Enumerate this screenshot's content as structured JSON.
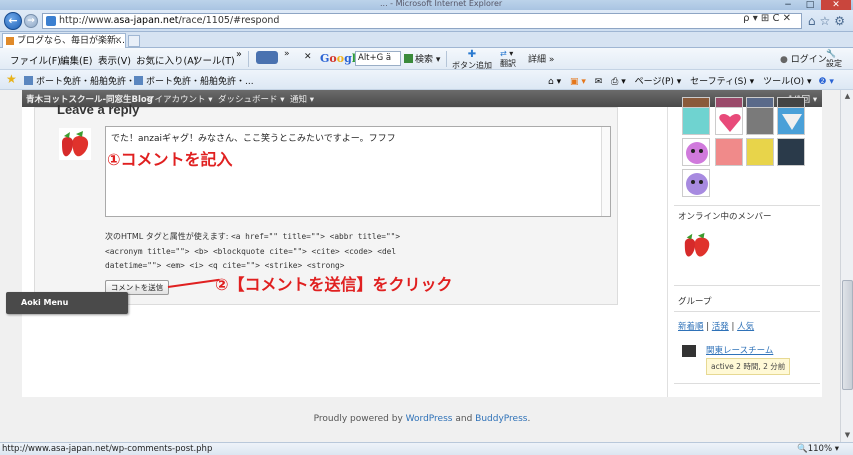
{
  "window": {
    "title": "... - Microsoft Internet Explorer"
  },
  "address": {
    "url_prefix": "http://www.",
    "url_domain": "asa-japan.net",
    "url_suffix": "/race/1105/#respond",
    "tools": "ρ ▾ ⊞ C ✕"
  },
  "tab": {
    "title": "ブログなら、毎日が楽新…",
    "close": "✕"
  },
  "menu": {
    "file": "ファイル(F)",
    "edit": "編集(E)",
    "view": "表示(V)",
    "favorites": "お気に入り(A)",
    "tools": "ツール(T)",
    "more": "»",
    "close_x": "✕",
    "google_search_value": "Alt+G ä",
    "search_btn": "検索",
    "button_add": "ボタン追加",
    "translate": "翻訳",
    "details": "詳細 »",
    "login": "ログイン",
    "settings": "設定"
  },
  "favbar": {
    "link1": "ボート免許・船舶免許・...",
    "link2": "ボート免許・船舶免許・...",
    "commands": {
      "page": "ページ(P) ▾",
      "safety": "セーフティ(S) ▾",
      "tools": "ツール(O) ▾",
      "help": "❷ ▾"
    }
  },
  "adminbar": {
    "site": "青木ヨットスクール-同窓生Blog",
    "my_account": "マイアカウント ▾",
    "dashboard": "ダッシュボード ▾",
    "notifications": "通知 ▾",
    "right_label": "1/1回 ▾"
  },
  "comment_form": {
    "heading": "Leave a reply",
    "textarea_value": "でた！anzaiギャグ！みなさん、ここ笑うとこみたいですよー。フフフ",
    "annotation1": "①コメントを記入",
    "allowed_intro": "次のHTML タグと属性が使えます:",
    "allowed_line1_code": "<a href=\"\" title=\"\"> <abbr title=\"\">",
    "allowed_line2_code": "<acronym title=\"\"> <b> <blockquote cite=\"\"> <cite> <code> <del",
    "allowed_line3_code": "datetime=\"\"> <em> <i> <q cite=\"\"> <strike> <strong>",
    "submit_label": "コメントを送信",
    "annotation2": "②【コメントを送信】をクリック"
  },
  "aoki_menu": {
    "label": "Aoki Menu"
  },
  "sidebar": {
    "online_members_title": "オンライン中のメンバー",
    "groups_title": "グループ",
    "group_tabs": {
      "newest": "新着順",
      "active": "活発",
      "popular": "人気"
    },
    "group_name": "関東レースチーム",
    "group_active": "active 2 時間, 2 分前"
  },
  "footer": {
    "prefix": "Proudly powered by ",
    "wordpress": "WordPress",
    "and": " and ",
    "buddypress": "BuddyPress",
    "suffix": "."
  },
  "status": {
    "url": "http://www.asa-japan.net/wp-comments-post.php",
    "zoom": "🔍110% ▾"
  },
  "colors": {
    "annotation": "#e02020",
    "link": "#2f72b8",
    "adminbar": "#4a4a4a"
  }
}
